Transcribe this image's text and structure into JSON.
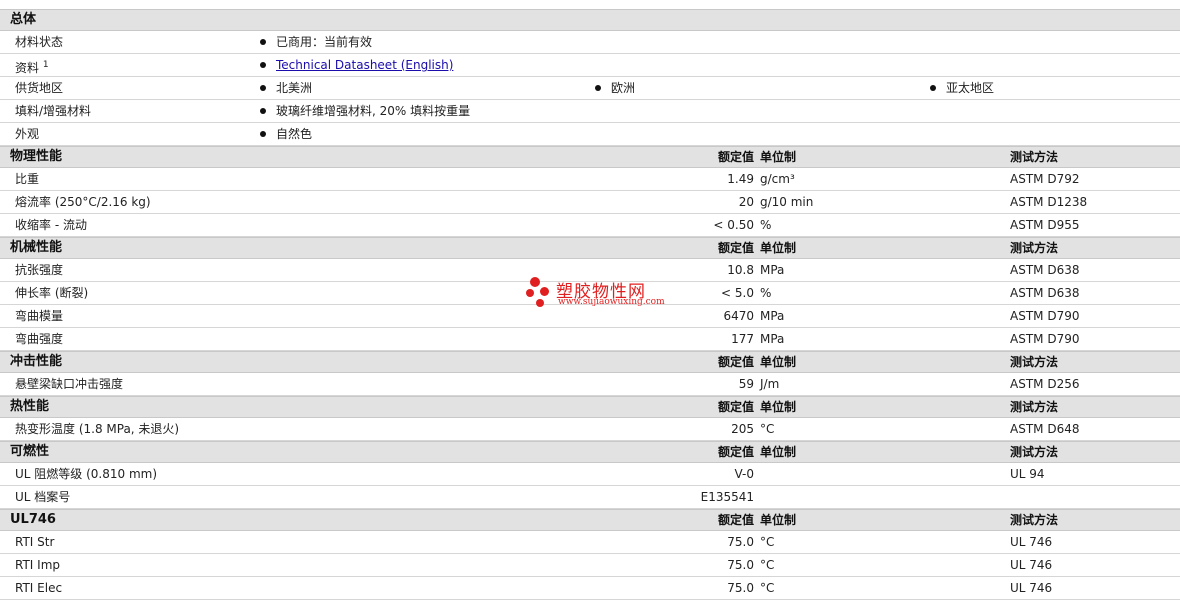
{
  "general": {
    "title": "总体",
    "rows": [
      {
        "label": "材料状态",
        "values": [
          "已商用：当前有效"
        ]
      },
      {
        "label": "资料",
        "sup": "1",
        "link": "Technical Datasheet (English)"
      },
      {
        "label": "供货地区",
        "values": [
          "北美洲",
          "欧洲",
          "亚太地区"
        ]
      },
      {
        "label": "填料/增强材料",
        "values": [
          "玻璃纤维增强材料, 20% 填料按重量"
        ]
      },
      {
        "label": "外观",
        "values": [
          "自然色"
        ]
      }
    ]
  },
  "headers": {
    "nominal": "额定值",
    "unit": "单位制",
    "method": "测试方法"
  },
  "sections": [
    {
      "title": "物理性能",
      "show_unit": true,
      "show_method": true,
      "rows": [
        {
          "label": "比重",
          "nominal": "1.49",
          "unit": "g/cm³",
          "method": "ASTM D792"
        },
        {
          "label": "熔流率 (250°C/2.16 kg)",
          "nominal": "20",
          "unit": "g/10 min",
          "method": "ASTM D1238"
        },
        {
          "label": "收缩率 - 流动",
          "nominal": "< 0.50",
          "unit": "%",
          "method": "ASTM D955"
        }
      ]
    },
    {
      "title": "机械性能",
      "show_unit": true,
      "show_method": true,
      "rows": [
        {
          "label": "抗张强度",
          "nominal": "10.8",
          "unit": "MPa",
          "method": "ASTM D638"
        },
        {
          "label": "伸长率 (断裂)",
          "nominal": "< 5.0",
          "unit": "%",
          "method": "ASTM D638"
        },
        {
          "label": "弯曲模量",
          "nominal": "6470",
          "unit": "MPa",
          "method": "ASTM D790"
        },
        {
          "label": "弯曲强度",
          "nominal": "177",
          "unit": "MPa",
          "method": "ASTM D790"
        }
      ]
    },
    {
      "title": "冲击性能",
      "show_unit": true,
      "show_method": true,
      "rows": [
        {
          "label": "悬壁梁缺口冲击强度",
          "nominal": "59",
          "unit": "J/m",
          "method": "ASTM D256"
        }
      ]
    },
    {
      "title": "热性能",
      "show_unit": true,
      "show_method": true,
      "rows": [
        {
          "label": "热变形温度 (1.8 MPa, 未退火)",
          "nominal": "205",
          "unit": "°C",
          "method": "ASTM D648"
        }
      ]
    },
    {
      "title": "可燃性",
      "show_unit": true,
      "show_method": true,
      "rows": [
        {
          "label": "UL 阻燃等级 (0.810 mm)",
          "nominal": "V-0",
          "unit": "",
          "method": "UL 94"
        },
        {
          "label": "UL 档案号",
          "nominal": "E135541",
          "unit": "",
          "method": ""
        }
      ]
    },
    {
      "title": "UL746",
      "show_unit": true,
      "show_method": true,
      "rows": [
        {
          "label": "RTI Str",
          "nominal": "75.0",
          "unit": "°C",
          "method": "UL 746"
        },
        {
          "label": "RTI Imp",
          "nominal": "75.0",
          "unit": "°C",
          "method": "UL 746"
        },
        {
          "label": "RTI Elec",
          "nominal": "75.0",
          "unit": "°C",
          "method": "UL 746"
        }
      ]
    }
  ],
  "watermark": {
    "cn": "塑胶物性网",
    "url": "www.sujiaowuxing.com",
    "color": "#e02020"
  }
}
